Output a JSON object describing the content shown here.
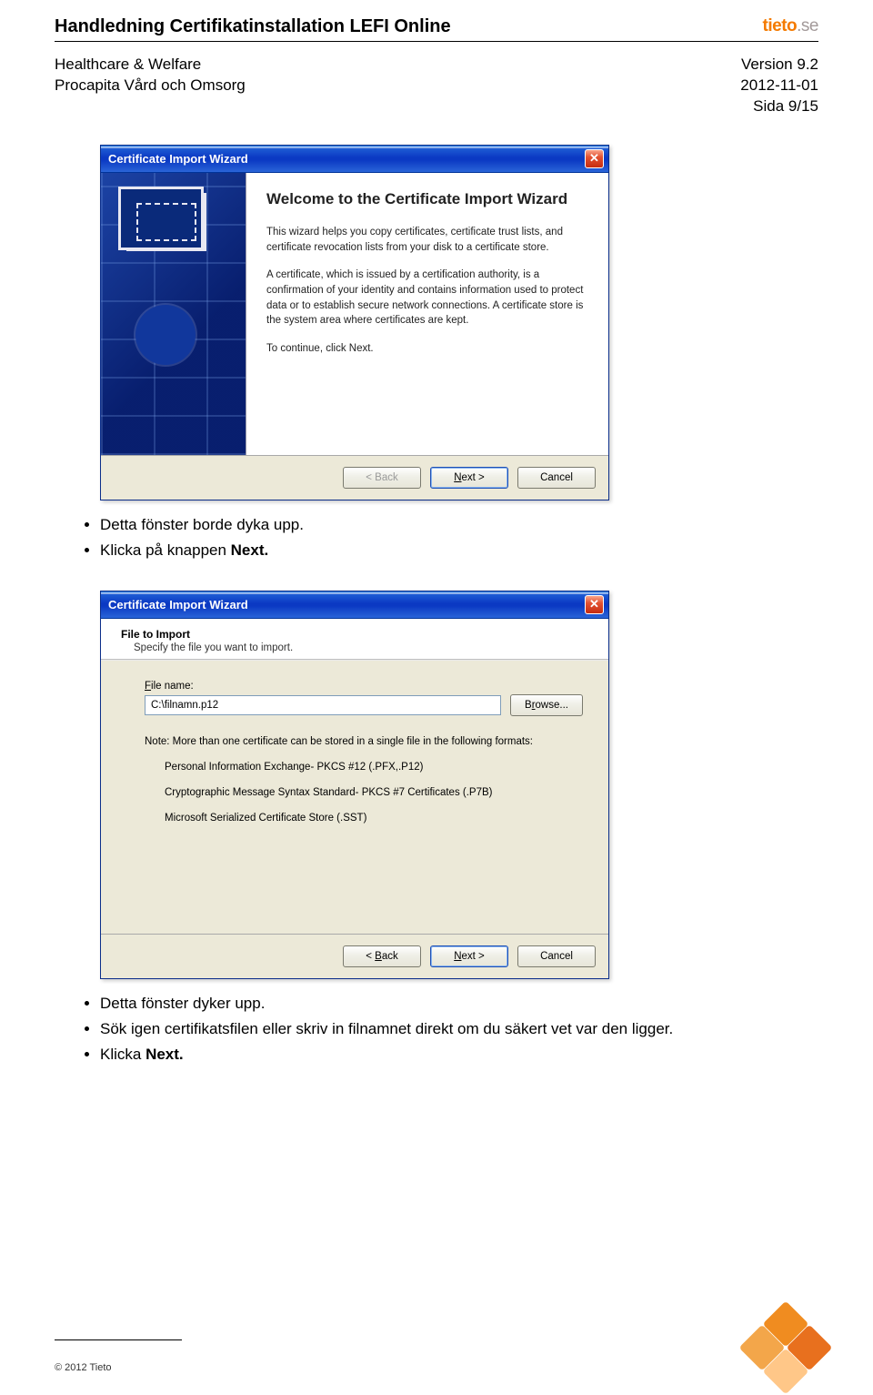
{
  "header": {
    "title": "Handledning Certifikatinstallation LEFI Online",
    "left_line1": "Healthcare & Welfare",
    "left_line2": "Procapita Vård och Omsorg",
    "right_line1": "Version 9.2",
    "right_line2": "2012-11-01",
    "right_line3": "Sida 9/15",
    "logo_main": "tieto",
    "logo_tld": ".se"
  },
  "wizard1": {
    "title": "Certificate Import Wizard",
    "heading": "Welcome to the Certificate Import Wizard",
    "p1": "This wizard helps you copy certificates, certificate trust lists, and certificate revocation lists from your disk to a certificate store.",
    "p2": "A certificate, which is issued by a certification authority, is a confirmation of your identity and contains information used to protect data or to establish secure network connections. A certificate store is the system area where certificates are kept.",
    "p3": "To continue, click Next.",
    "btn_back": "< Back",
    "btn_next": "Next >",
    "btn_cancel": "Cancel"
  },
  "bullets1": {
    "b1": "Detta fönster borde dyka upp.",
    "b2_pre": "Klicka på knappen ",
    "b2_bold": "Next."
  },
  "wizard2": {
    "title": "Certificate Import Wizard",
    "h2": "File to Import",
    "h2sub": "Specify the file you want to import.",
    "file_label": "File name:",
    "file_value": "C:\\filnamn.p12",
    "browse": "Browse...",
    "note": "Note:  More than one certificate can be stored in a single file in the following formats:",
    "fmt1": "Personal Information Exchange- PKCS #12 (.PFX,.P12)",
    "fmt2": "Cryptographic Message Syntax Standard- PKCS #7 Certificates (.P7B)",
    "fmt3": "Microsoft Serialized Certificate Store (.SST)",
    "btn_back": "< Back",
    "btn_next": "Next >",
    "btn_cancel": "Cancel"
  },
  "bullets2": {
    "b1": "Detta fönster dyker upp.",
    "b2": "Sök igen certifikatsfilen eller skriv in filnamnet direkt om du säkert vet var den ligger.",
    "b3_pre": "Klicka ",
    "b3_bold": "Next."
  },
  "footer": {
    "copyright": "© 2012 Tieto"
  }
}
